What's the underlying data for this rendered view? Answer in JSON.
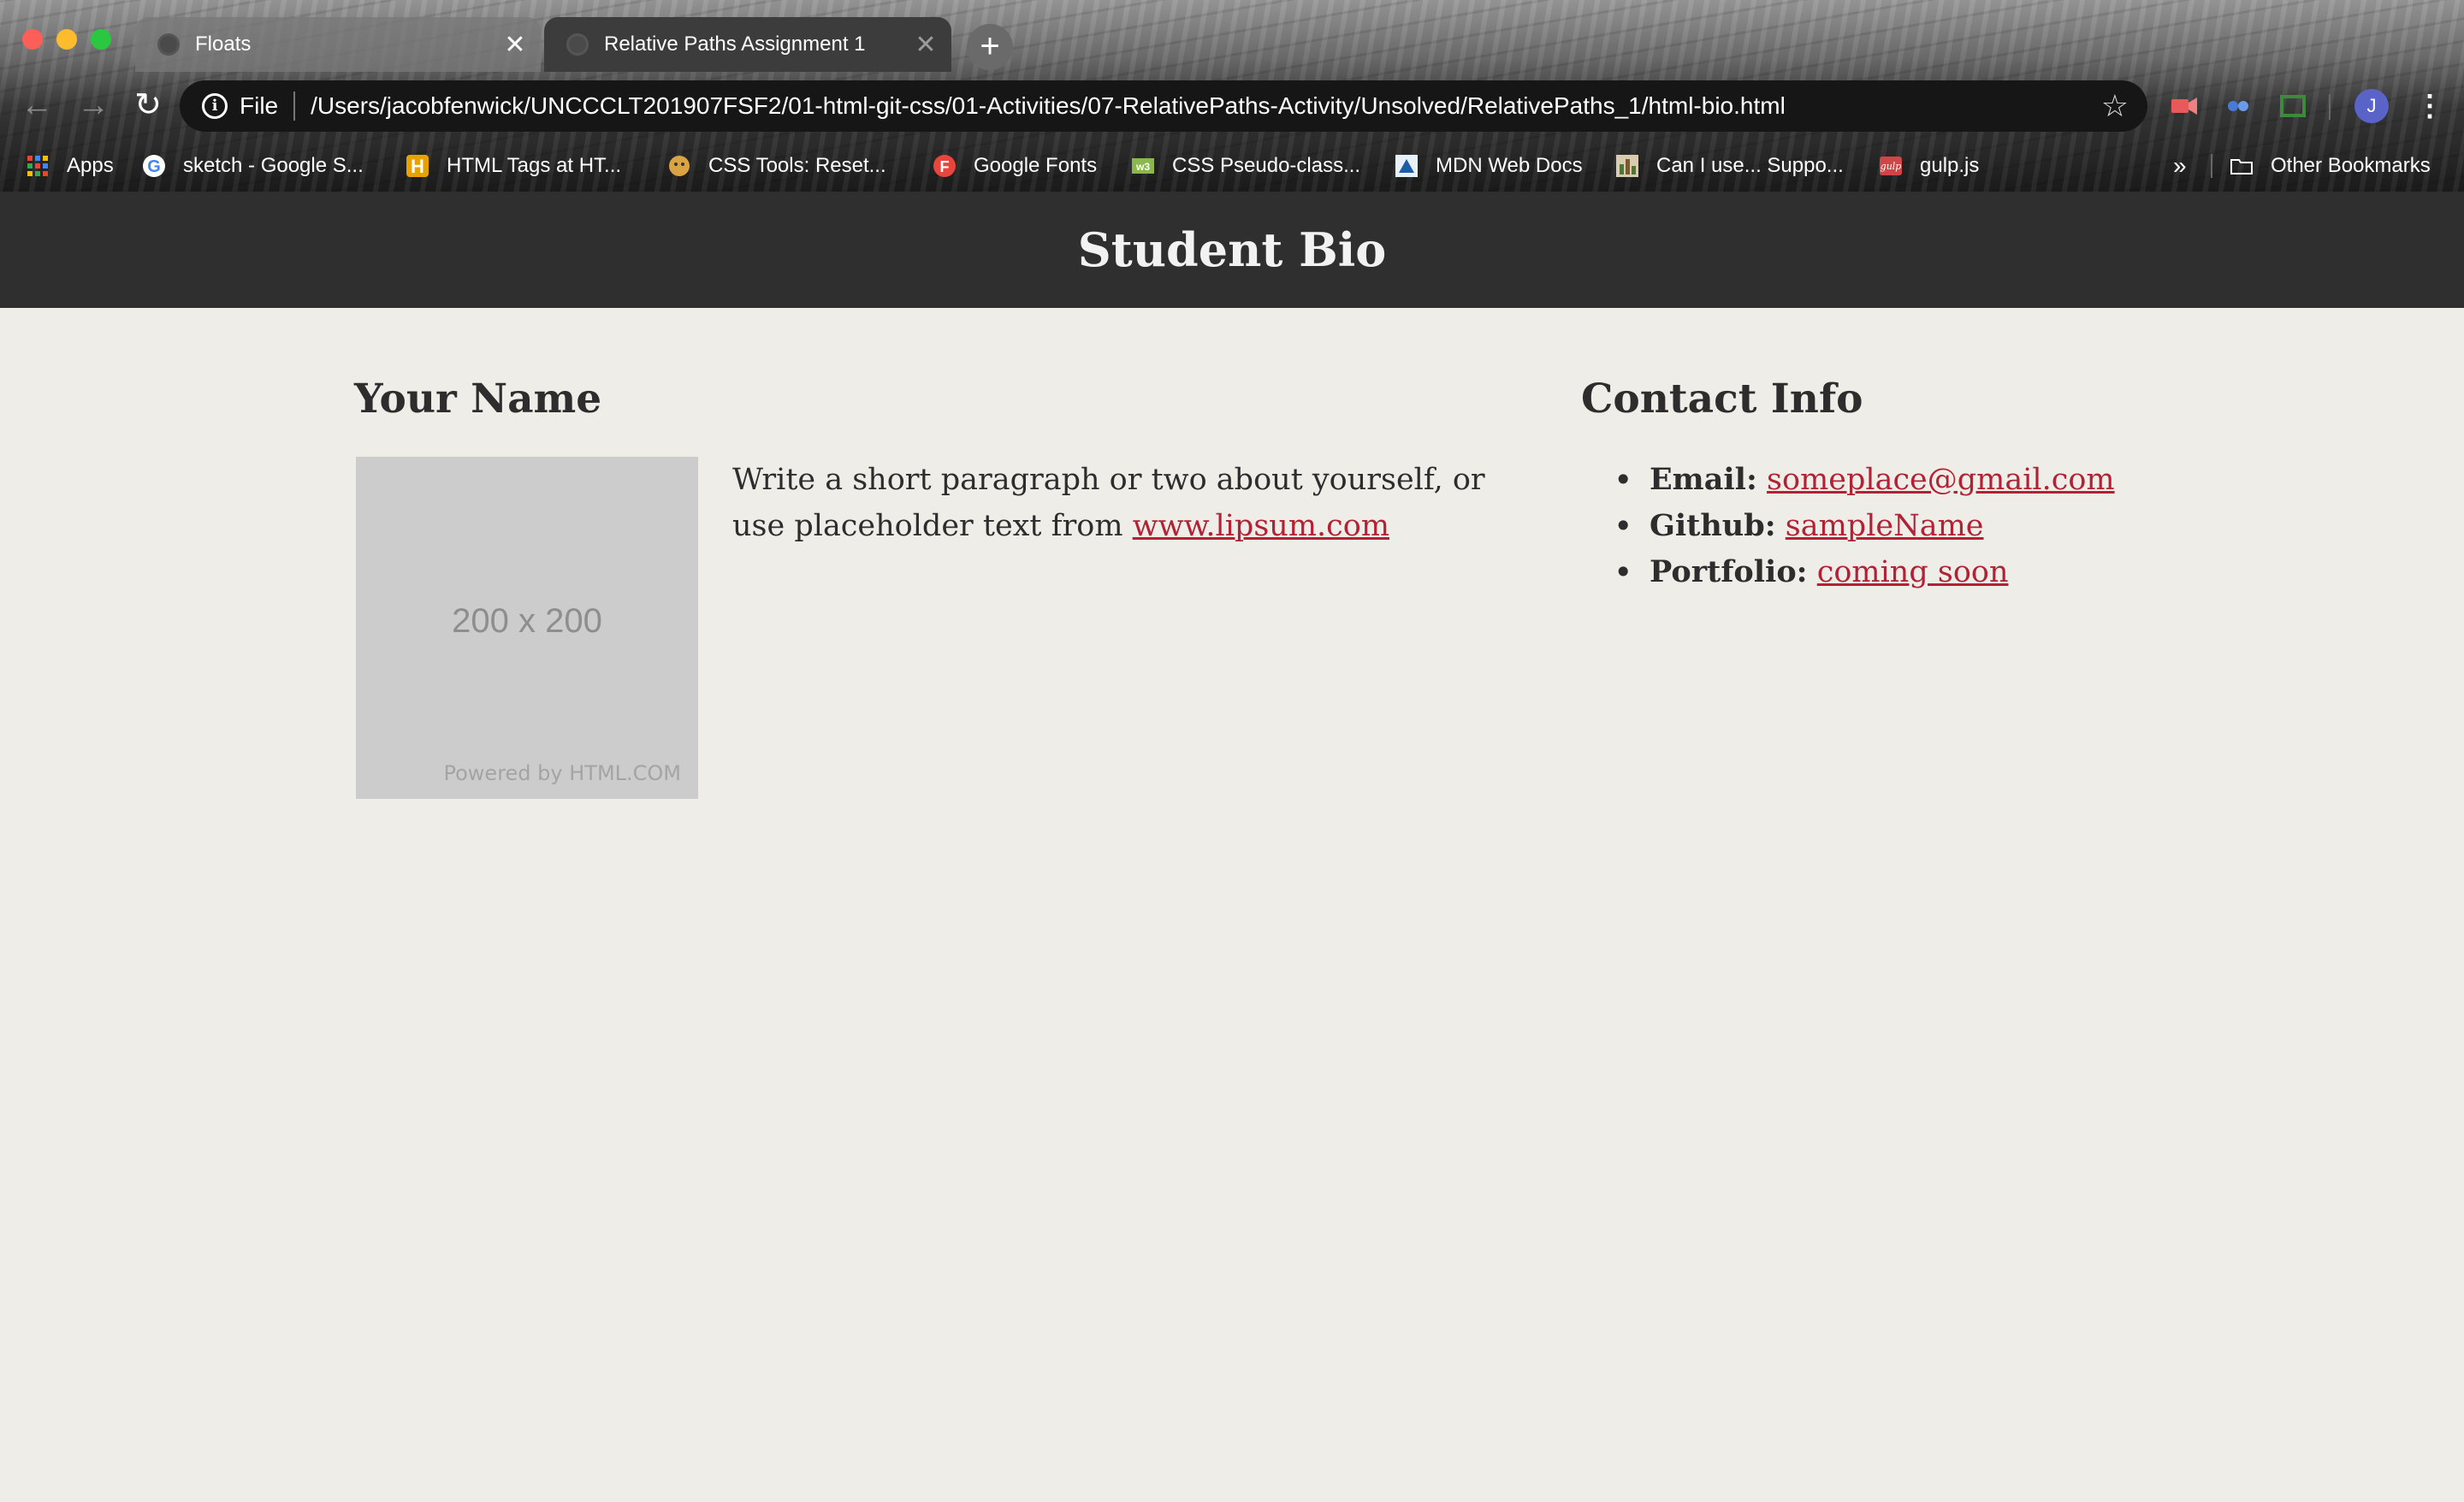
{
  "browser": {
    "tabs": [
      {
        "title": "Floats",
        "active": false
      },
      {
        "title": "Relative Paths Assignment 1",
        "active": true
      }
    ],
    "new_tab_label": "+",
    "address": {
      "scheme": "File",
      "url": "/Users/jacobfenwick/UNCCCLT201907FSF2/01-html-git-css/01-Activities/07-RelativePaths-Activity/Unsolved/RelativePaths_1/html-bio.html"
    },
    "profile_initial": "J",
    "bookmarks": [
      {
        "label": "Apps",
        "icon": "apps-grid-icon"
      },
      {
        "label": "sketch - Google S...",
        "icon": "google-icon"
      },
      {
        "label": "HTML Tags at HT...",
        "icon": "html-h-icon"
      },
      {
        "label": "CSS Tools: Reset...",
        "icon": "css-tools-icon"
      },
      {
        "label": "Google Fonts",
        "icon": "google-fonts-icon"
      },
      {
        "label": "CSS Pseudo-class...",
        "icon": "w3-icon"
      },
      {
        "label": "MDN Web Docs",
        "icon": "mdn-icon"
      },
      {
        "label": "Can I use... Suppo...",
        "icon": "caniuse-icon"
      },
      {
        "label": "gulp.js",
        "icon": "gulp-icon"
      }
    ],
    "bookmarks_overflow": "»",
    "other_bookmarks": "Other Bookmarks"
  },
  "page": {
    "title": "Student Bio",
    "main": {
      "heading": "Your Name",
      "image": {
        "dims": "200 x 200",
        "caption": "Powered by HTML.COM"
      },
      "bio_prefix": "Write a short paragraph or two about yourself, or use placeholder text from ",
      "bio_link": "www.lipsum.com"
    },
    "contact": {
      "heading": "Contact Info",
      "items": [
        {
          "label": "Email:",
          "link": "someplace@gmail.com"
        },
        {
          "label": "Github:",
          "link": "sampleName"
        },
        {
          "label": "Portfolio:",
          "link": "coming soon"
        }
      ]
    }
  },
  "colors": {
    "header_bg": "#2f2f2f",
    "page_bg": "#efede8",
    "link": "#b22234",
    "text": "#2d2d2d"
  }
}
